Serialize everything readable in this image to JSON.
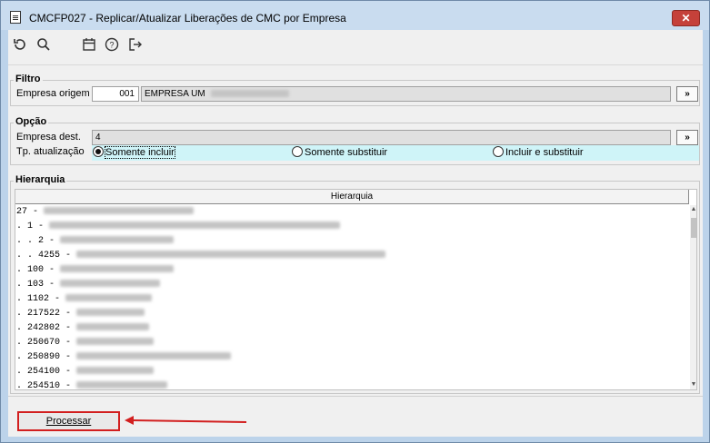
{
  "window": {
    "title": "CMCFP027 - Replicar/Atualizar Liberações de CMC por Empresa",
    "close_label": "✕"
  },
  "toolbar": {
    "icons": [
      "refresh-icon",
      "search-icon",
      "calendar-icon",
      "help-icon",
      "exit-icon"
    ]
  },
  "filtro": {
    "title": "Filtro",
    "empresa_origem_label": "Empresa origem",
    "empresa_origem_code": "001",
    "empresa_origem_name": "EMPRESA UM",
    "lookup_label": "»"
  },
  "opcao": {
    "title": "Opção",
    "empresa_dest_label": "Empresa dest.",
    "empresa_dest_value": "4",
    "lookup_label": "»",
    "tp_atualizacao_label": "Tp. atualização",
    "options": [
      {
        "label": "Somente incluir",
        "selected": true
      },
      {
        "label": "Somente substituir",
        "selected": false
      },
      {
        "label": "Incluir e substituir",
        "selected": false
      }
    ]
  },
  "hierarquia": {
    "title": "Hierarquia",
    "column_header": "Hierarquia",
    "rows": [
      {
        "prefix": "27 -"
      },
      {
        "prefix": ". 1 -"
      },
      {
        "prefix": ". . 2 -"
      },
      {
        "prefix": ". . 4255 -"
      },
      {
        "prefix": ". 100 -"
      },
      {
        "prefix": ". 103 -"
      },
      {
        "prefix": ". 1102 -"
      },
      {
        "prefix": ". 217522 -"
      },
      {
        "prefix": ". 242802 -"
      },
      {
        "prefix": ". 250670 -"
      },
      {
        "prefix": ". 250890 -"
      },
      {
        "prefix": ". 254100 -"
      },
      {
        "prefix": ". 254510 -"
      }
    ]
  },
  "footer": {
    "process_label": "Processar"
  }
}
